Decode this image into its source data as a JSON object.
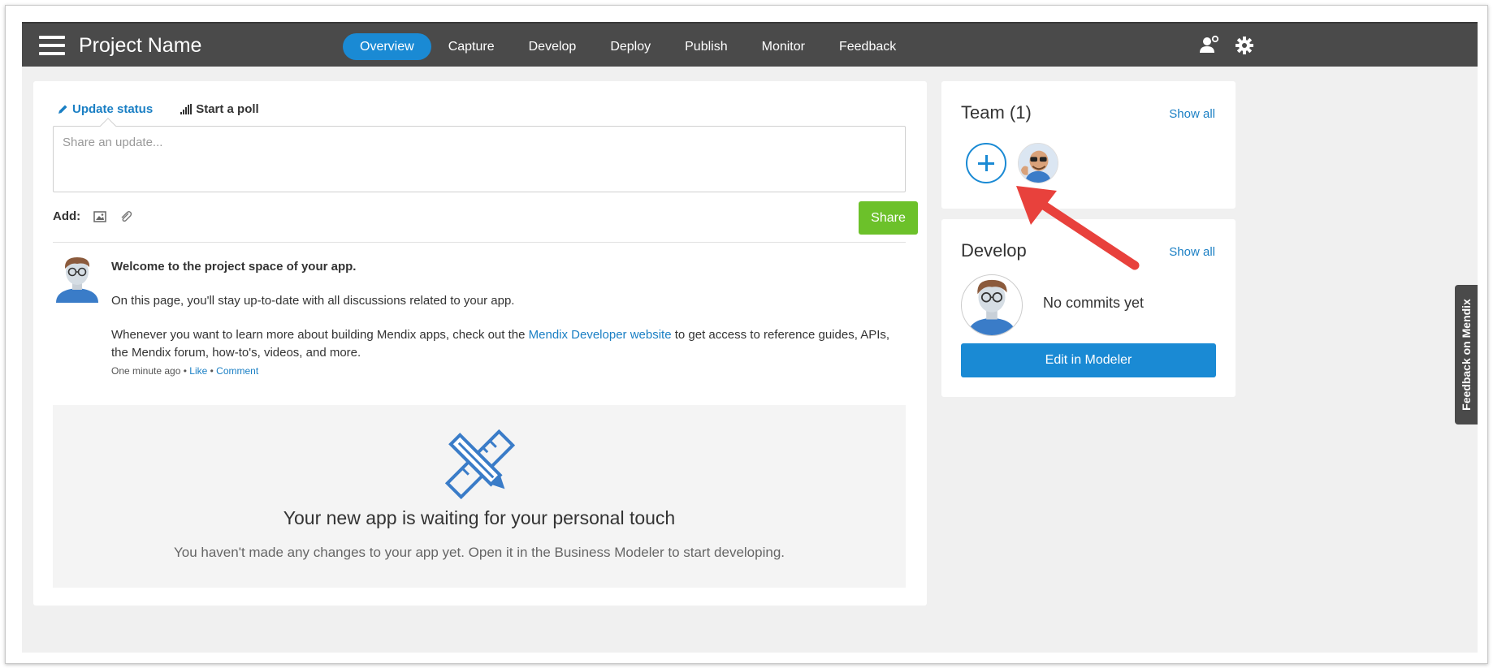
{
  "header": {
    "project_name": "Project Name",
    "nav": [
      {
        "label": "Overview",
        "active": true
      },
      {
        "label": "Capture"
      },
      {
        "label": "Develop"
      },
      {
        "label": "Deploy"
      },
      {
        "label": "Publish"
      },
      {
        "label": "Monitor"
      },
      {
        "label": "Feedback"
      }
    ],
    "icons": [
      "menu-icon",
      "user-settings-icon",
      "gear-icon"
    ]
  },
  "composer": {
    "tabs": [
      {
        "label": "Update status",
        "icon": "pencil-icon",
        "active": true
      },
      {
        "label": "Start a poll",
        "icon": "bar-chart-icon",
        "active": false
      }
    ],
    "placeholder": "Share an update...",
    "add_label": "Add:",
    "share_label": "Share"
  },
  "post": {
    "heading": "Welcome to the project space of your app.",
    "body1": "On this page, you'll stay up-to-date with all discussions related to your app.",
    "body2_before": "Whenever you want to learn more about building Mendix apps, check out the ",
    "body2_link": "Mendix Developer website",
    "body2_after": " to get access to reference guides, APIs, the Mendix forum, how-to's, videos, and more.",
    "time": "One minute ago",
    "sep": " • ",
    "like": "Like",
    "comment": "Comment"
  },
  "empty_state": {
    "title": "Your new app is waiting for your personal touch",
    "subtitle": "You haven't made any changes to your app yet. Open it in the Business Modeler to start developing."
  },
  "team": {
    "title": "Team (1)",
    "show_all": "Show all"
  },
  "develop": {
    "title": "Develop",
    "show_all": "Show all",
    "no_commits": "No commits yet",
    "edit_button": "Edit in Modeler"
  },
  "feedback_tab": "Feedback on Mendix",
  "colors": {
    "accent": "#1a8ad4",
    "share_green": "#6cc12a",
    "topbar": "#4a4a4a",
    "annotation_arrow": "#e8413c"
  }
}
